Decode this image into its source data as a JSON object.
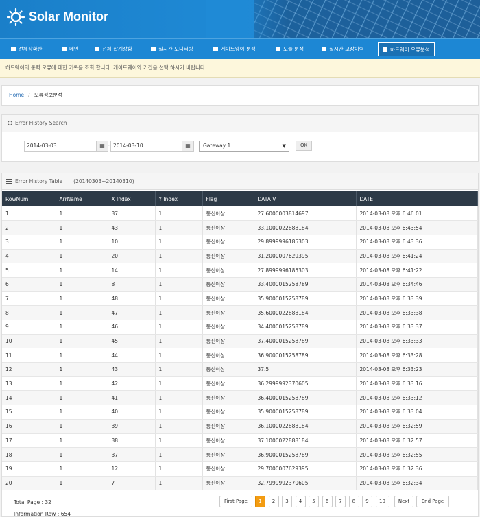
{
  "app": {
    "title": "Solar Monitor"
  },
  "nav": [
    {
      "label": "전체상황판",
      "icon": "home-icon"
    },
    {
      "label": "메인",
      "icon": "home-icon"
    },
    {
      "label": "전체 합계상황",
      "icon": "document-icon"
    },
    {
      "label": "실시간 모니터링",
      "icon": "video-icon"
    },
    {
      "label": "게이트웨이 분석",
      "icon": "cluster-icon"
    },
    {
      "label": "모듈 분석",
      "icon": "cluster-icon"
    },
    {
      "label": "실시간 고장이력",
      "icon": "cluster-icon"
    },
    {
      "label": "하드웨어 오류분석",
      "icon": "external-link-icon"
    }
  ],
  "notice": "하드웨어의 통력 오류에 대한 기록을 조회 합니다. 게이트웨이와 기간을 선택 하시기 바랍니다.",
  "breadcrumb": {
    "home": "Home",
    "current": "오류정보분석"
  },
  "search": {
    "title": "Error History Search",
    "from_date": "2014-03-03",
    "to_date": "2014-03-10",
    "dash": "-",
    "calendar_icon": "calendar-icon",
    "gateway": "Gateway 1",
    "ok_label": "OK"
  },
  "table": {
    "title": "Error History Table",
    "range": "(20140303~20140310)",
    "columns": [
      "RowNum",
      "ArrName",
      "X Index",
      "Y Index",
      "Flag",
      "DATA V",
      "DATE"
    ],
    "rows": [
      [
        "1",
        "1",
        "37",
        "1",
        "통신이상",
        "27.6000003814697",
        "2014-03-08 오후 6:46:01"
      ],
      [
        "2",
        "1",
        "43",
        "1",
        "통신이상",
        "33.1000022888184",
        "2014-03-08 오후 6:43:54"
      ],
      [
        "3",
        "1",
        "10",
        "1",
        "통신이상",
        "29.8999996185303",
        "2014-03-08 오후 6:43:36"
      ],
      [
        "4",
        "1",
        "20",
        "1",
        "통신이상",
        "31.2000007629395",
        "2014-03-08 오후 6:41:24"
      ],
      [
        "5",
        "1",
        "14",
        "1",
        "통신이상",
        "27.8999996185303",
        "2014-03-08 오후 6:41:22"
      ],
      [
        "6",
        "1",
        "8",
        "1",
        "통신이상",
        "33.4000015258789",
        "2014-03-08 오후 6:34:46"
      ],
      [
        "7",
        "1",
        "48",
        "1",
        "통신이상",
        "35.9000015258789",
        "2014-03-08 오후 6:33:39"
      ],
      [
        "8",
        "1",
        "47",
        "1",
        "통신이상",
        "35.6000022888184",
        "2014-03-08 오후 6:33:38"
      ],
      [
        "9",
        "1",
        "46",
        "1",
        "통신이상",
        "34.4000015258789",
        "2014-03-08 오후 6:33:37"
      ],
      [
        "10",
        "1",
        "45",
        "1",
        "통신이상",
        "37.4000015258789",
        "2014-03-08 오후 6:33:33"
      ],
      [
        "11",
        "1",
        "44",
        "1",
        "통신이상",
        "36.9000015258789",
        "2014-03-08 오후 6:33:28"
      ],
      [
        "12",
        "1",
        "43",
        "1",
        "통신이상",
        "37.5",
        "2014-03-08 오후 6:33:23"
      ],
      [
        "13",
        "1",
        "42",
        "1",
        "통신이상",
        "36.2999992370605",
        "2014-03-08 오후 6:33:16"
      ],
      [
        "14",
        "1",
        "41",
        "1",
        "통신이상",
        "36.4000015258789",
        "2014-03-08 오후 6:33:12"
      ],
      [
        "15",
        "1",
        "40",
        "1",
        "통신이상",
        "35.9000015258789",
        "2014-03-08 오후 6:33:04"
      ],
      [
        "16",
        "1",
        "39",
        "1",
        "통신이상",
        "36.1000022888184",
        "2014-03-08 오후 6:32:59"
      ],
      [
        "17",
        "1",
        "38",
        "1",
        "통신이상",
        "37.1000022888184",
        "2014-03-08 오후 6:32:57"
      ],
      [
        "18",
        "1",
        "37",
        "1",
        "통신이상",
        "36.9000015258789",
        "2014-03-08 오후 6:32:55"
      ],
      [
        "19",
        "1",
        "12",
        "1",
        "통신이상",
        "29.7000007629395",
        "2014-03-08 오후 6:32:36"
      ],
      [
        "20",
        "1",
        "7",
        "1",
        "통신이상",
        "32.7999992370605",
        "2014-03-08 오후 6:32:34"
      ]
    ]
  },
  "footer": {
    "total_page": "Total Page : 32",
    "info_row": "Information Row : 654"
  },
  "pager": {
    "first": "First Page",
    "pages": [
      "1",
      "2",
      "3",
      "4",
      "5",
      "6",
      "7",
      "8",
      "9",
      "10"
    ],
    "active": "1",
    "next": "Next",
    "end": "End Page"
  },
  "colors": {
    "header": "#1f8ad6",
    "nav": "#1d87d4",
    "table_head": "#2d3a47",
    "pager_active": "#f39c12"
  }
}
